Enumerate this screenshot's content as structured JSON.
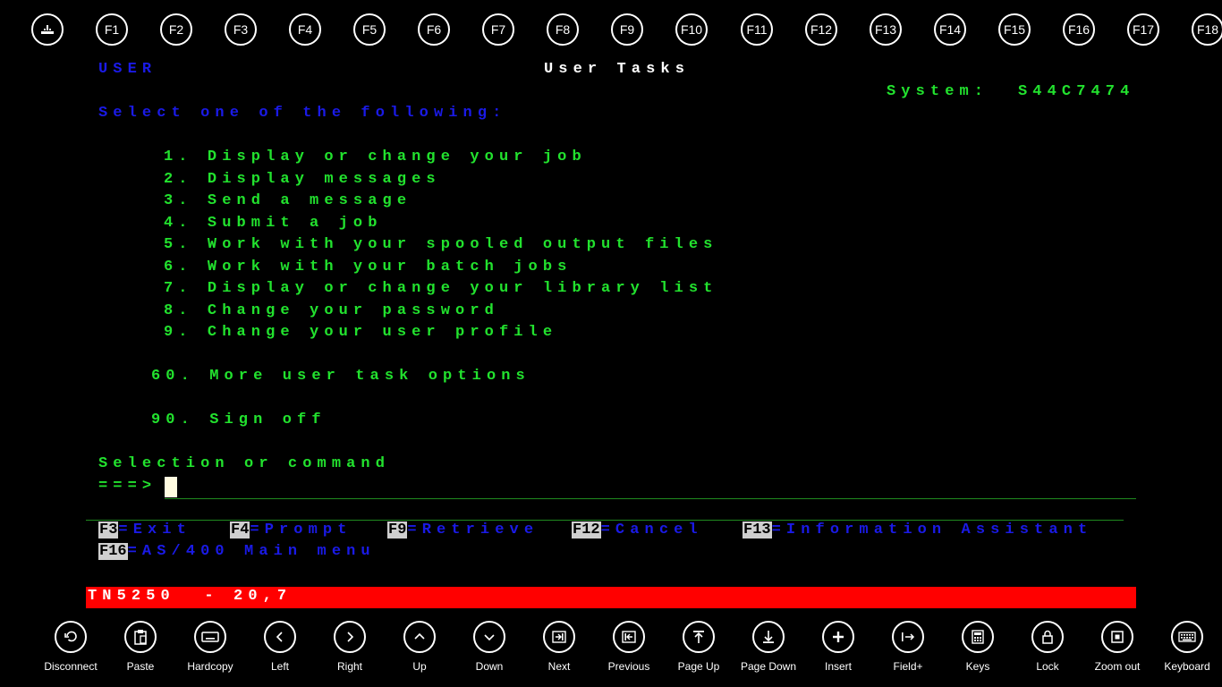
{
  "function_keys": [
    "F1",
    "F2",
    "F3",
    "F4",
    "F5",
    "F6",
    "F7",
    "F8",
    "F9",
    "F10",
    "F11",
    "F12",
    "F13",
    "F14",
    "F15",
    "F16",
    "F17",
    "F18"
  ],
  "first_key_icon": "keyboard-input-icon",
  "terminal": {
    "user": "USER",
    "title": "User Tasks",
    "system_label": "System:",
    "system_name": "S44C7474",
    "prompt": "Select one of the following:",
    "options": [
      "1. Display or change your job",
      "2. Display messages",
      "3. Send a message",
      "4. Submit a job",
      "5. Work with your spooled output files",
      "6. Work with your batch jobs",
      "7. Display or change your library list",
      "8. Change your password",
      "9. Change your user profile"
    ],
    "option_60": "60. More user task options",
    "option_90": "90. Sign off",
    "selection_label": "Selection or command",
    "arrow": "===>",
    "fkeys": [
      {
        "key": "F3",
        "text": "=Exit"
      },
      {
        "key": "F4",
        "text": "=Prompt"
      },
      {
        "key": "F9",
        "text": "=Retrieve"
      },
      {
        "key": "F12",
        "text": "=Cancel"
      },
      {
        "key": "F13",
        "text": "=Information Assistant"
      },
      {
        "key": "F16",
        "text": "=AS/400 Main menu"
      }
    ]
  },
  "status_bar": {
    "text": "TN5250  - 20,7",
    "color": "#ff0000"
  },
  "app_bar": [
    {
      "label": "Disconnect",
      "icon": "undo-icon"
    },
    {
      "label": "Paste",
      "icon": "paste-icon"
    },
    {
      "label": "Hardcopy",
      "icon": "keyboard-icon"
    },
    {
      "label": "Left",
      "icon": "chevron-left-icon"
    },
    {
      "label": "Right",
      "icon": "chevron-right-icon"
    },
    {
      "label": "Up",
      "icon": "chevron-up-icon"
    },
    {
      "label": "Down",
      "icon": "chevron-down-icon"
    },
    {
      "label": "Next",
      "icon": "next-field-icon"
    },
    {
      "label": "Previous",
      "icon": "previous-field-icon"
    },
    {
      "label": "Page Up",
      "icon": "page-up-icon"
    },
    {
      "label": "Page Down",
      "icon": "page-down-icon"
    },
    {
      "label": "Insert",
      "icon": "plus-icon"
    },
    {
      "label": "Field+",
      "icon": "field-plus-icon"
    },
    {
      "label": "Keys",
      "icon": "calculator-icon"
    },
    {
      "label": "Lock",
      "icon": "lock-icon"
    },
    {
      "label": "Zoom out",
      "icon": "zoom-out-icon"
    },
    {
      "label": "Keyboard",
      "icon": "keyboard-icon"
    }
  ],
  "colors": {
    "green": "#22e22e",
    "blue": "#1a1ae6",
    "status": "#ff0000"
  }
}
